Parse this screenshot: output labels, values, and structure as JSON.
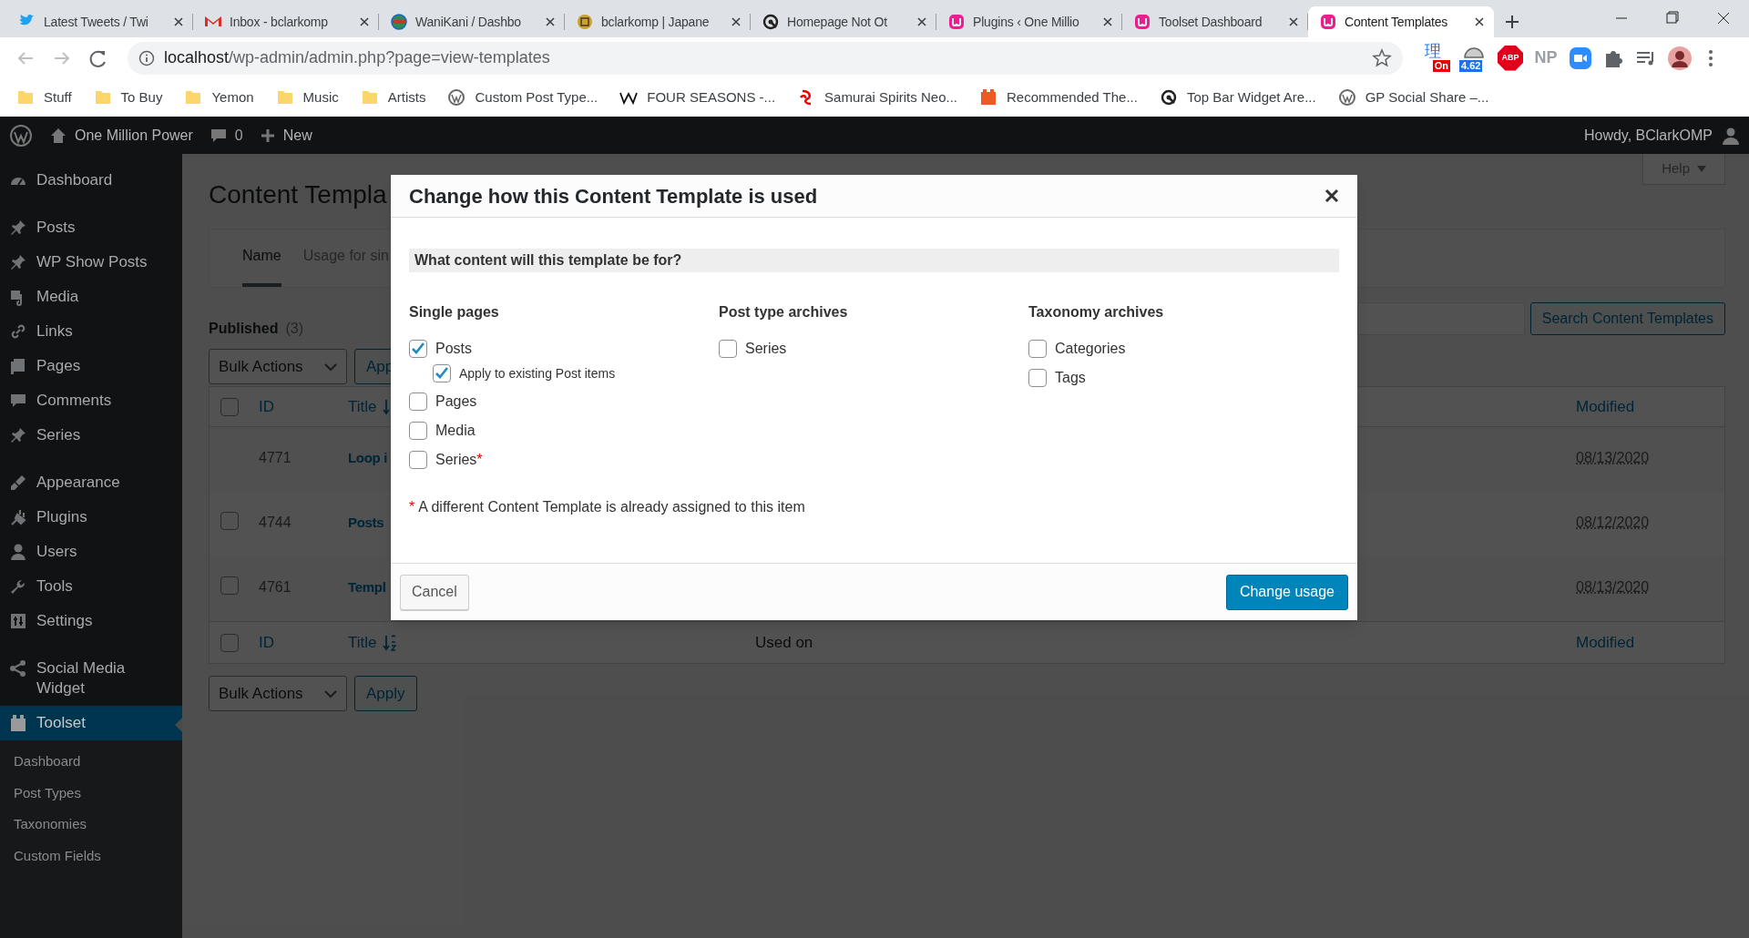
{
  "browser": {
    "tabs": [
      {
        "title": "Latest Tweets / Twi",
        "kind": "bird",
        "selected": false
      },
      {
        "title": "Inbox - bclarkomp",
        "kind": "mail",
        "selected": false
      },
      {
        "title": "WaniKani / Dashbo",
        "kind": "globe",
        "selected": false
      },
      {
        "title": "bclarkomp | Japane",
        "kind": "seal",
        "selected": false
      },
      {
        "title": "Homepage Not Ot",
        "kind": "ring",
        "selected": false
      },
      {
        "title": "Plugins ‹ One Millio",
        "kind": "toolset",
        "selected": false
      },
      {
        "title": "Toolset Dashboard",
        "kind": "toolset",
        "selected": false
      },
      {
        "title": "Content Templates",
        "kind": "toolset",
        "selected": true
      }
    ],
    "url": {
      "host": "localhost",
      "path": "/wp-admin/admin.php?page=view-templates"
    },
    "extensions": [
      {
        "kind": "translate",
        "glyph": "理",
        "badge": "On"
      },
      {
        "kind": "speed",
        "badge": "4.62"
      },
      {
        "kind": "stop",
        "label": "ABP"
      },
      {
        "kind": "text",
        "label": "NP"
      },
      {
        "kind": "camera"
      },
      {
        "kind": "puzzle"
      },
      {
        "kind": "media"
      },
      {
        "kind": "avatar"
      }
    ],
    "bookmarks": [
      {
        "label": "Stuff",
        "kind": "folder"
      },
      {
        "label": "To Buy",
        "kind": "folder"
      },
      {
        "label": "Yemon",
        "kind": "folder"
      },
      {
        "label": "Music",
        "kind": "folder"
      },
      {
        "label": "Artists",
        "kind": "folder"
      },
      {
        "label": "Custom Post Type...",
        "kind": "wp"
      },
      {
        "label": "FOUR SEASONS -...",
        "kind": "wiki"
      },
      {
        "label": "Samurai Spirits Neo...",
        "kind": "red"
      },
      {
        "label": "Recommended The...",
        "kind": "orange"
      },
      {
        "label": "Top Bar Widget Are...",
        "kind": "ring"
      },
      {
        "label": "GP Social Share –...",
        "kind": "wp"
      }
    ]
  },
  "admin_bar": {
    "site_name": "One Million Power",
    "comments": "0",
    "new_label": "New",
    "greeting": "Howdy, BClarkOMP"
  },
  "sidebar": {
    "groups": [
      [
        {
          "label": "Dashboard",
          "kind": "gauge",
          "selected": false
        }
      ],
      [
        {
          "label": "Posts",
          "kind": "pin",
          "selected": false
        },
        {
          "label": "WP Show Posts",
          "kind": "pin",
          "selected": false
        },
        {
          "label": "Media",
          "kind": "media",
          "selected": false
        },
        {
          "label": "Links",
          "kind": "link",
          "selected": false
        },
        {
          "label": "Pages",
          "kind": "pages",
          "selected": false
        },
        {
          "label": "Comments",
          "kind": "bubble",
          "selected": false
        },
        {
          "label": "Series",
          "kind": "pin",
          "selected": false
        }
      ],
      [
        {
          "label": "Appearance",
          "kind": "brush",
          "selected": false
        },
        {
          "label": "Plugins",
          "kind": "plug",
          "selected": false
        },
        {
          "label": "Users",
          "kind": "user",
          "selected": false
        },
        {
          "label": "Tools",
          "kind": "wrench",
          "selected": false
        },
        {
          "label": "Settings",
          "kind": "sliders",
          "selected": false
        }
      ],
      [
        {
          "label": "Social Media Widget",
          "kind": "share",
          "selected": false
        },
        {
          "label": "Toolset",
          "kind": "toolset",
          "selected": true
        }
      ]
    ],
    "submenu": [
      "Dashboard",
      "Post Types",
      "Taxonomies",
      "Custom Fields"
    ]
  },
  "page": {
    "title": "Content Templa",
    "help": "Help",
    "tabs": [
      {
        "label": "Name",
        "selected": true
      },
      {
        "label": "Usage for sin",
        "selected": false
      }
    ],
    "status": {
      "label": "Published",
      "count": "(3)"
    },
    "bulk_actions": "Bulk Actions",
    "apply_top": "App",
    "search_button": "Search Content Templates",
    "header": {
      "id": "ID",
      "title": "Title",
      "modified": "Modified",
      "checked": false
    },
    "rows": [
      {
        "id": "4771",
        "title": "Loop i",
        "modified": "08/13/2020",
        "has_checkbox": false
      },
      {
        "id": "4744",
        "title": "Posts",
        "modified": "08/12/2020",
        "has_checkbox": true,
        "checked": false
      },
      {
        "id": "4761",
        "title": "Templ",
        "modified": "08/13/2020",
        "has_checkbox": true,
        "checked": false
      }
    ],
    "footer": {
      "id": "ID",
      "title": "Title",
      "used_on": "Used on",
      "modified": "Modified",
      "checked": false
    },
    "bulk_actions_bottom": "Bulk Actions",
    "apply_bottom": "Apply"
  },
  "dialog": {
    "title": "Change how this Content Template is used",
    "question": "What content will this template be for?",
    "columns": [
      {
        "heading": "Single pages",
        "options": [
          {
            "label": "Posts",
            "checked": true,
            "children": [
              {
                "label": "Apply to existing Post items",
                "checked": true
              }
            ]
          },
          {
            "label": "Pages",
            "checked": false
          },
          {
            "label": "Media",
            "checked": false
          },
          {
            "label": "Series",
            "checked": false,
            "mark": "*"
          }
        ]
      },
      {
        "heading": "Post type archives",
        "options": [
          {
            "label": "Series",
            "checked": false
          }
        ]
      },
      {
        "heading": "Taxonomy archives",
        "options": [
          {
            "label": "Categories",
            "checked": false
          },
          {
            "label": "Tags",
            "checked": false
          }
        ]
      }
    ],
    "footnote": {
      "mark": "*",
      "text": "A different Content Template is already assigned to this item"
    },
    "cancel": "Cancel",
    "confirm": "Change usage"
  }
}
